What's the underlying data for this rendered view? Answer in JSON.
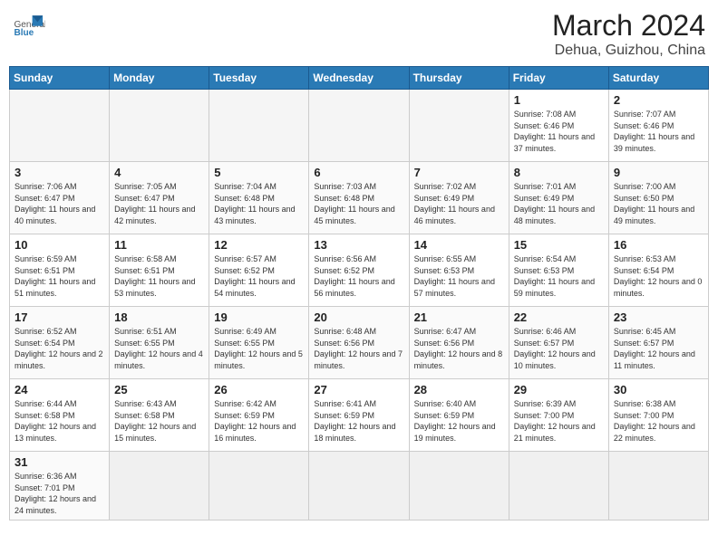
{
  "header": {
    "logo_general": "General",
    "logo_blue": "Blue",
    "title": "March 2024",
    "subtitle": "Dehua, Guizhou, China"
  },
  "weekdays": [
    "Sunday",
    "Monday",
    "Tuesday",
    "Wednesday",
    "Thursday",
    "Friday",
    "Saturday"
  ],
  "weeks": [
    [
      {
        "day": "",
        "info": ""
      },
      {
        "day": "",
        "info": ""
      },
      {
        "day": "",
        "info": ""
      },
      {
        "day": "",
        "info": ""
      },
      {
        "day": "",
        "info": ""
      },
      {
        "day": "1",
        "info": "Sunrise: 7:08 AM\nSunset: 6:46 PM\nDaylight: 11 hours and 37 minutes."
      },
      {
        "day": "2",
        "info": "Sunrise: 7:07 AM\nSunset: 6:46 PM\nDaylight: 11 hours and 39 minutes."
      }
    ],
    [
      {
        "day": "3",
        "info": "Sunrise: 7:06 AM\nSunset: 6:47 PM\nDaylight: 11 hours and 40 minutes."
      },
      {
        "day": "4",
        "info": "Sunrise: 7:05 AM\nSunset: 6:47 PM\nDaylight: 11 hours and 42 minutes."
      },
      {
        "day": "5",
        "info": "Sunrise: 7:04 AM\nSunset: 6:48 PM\nDaylight: 11 hours and 43 minutes."
      },
      {
        "day": "6",
        "info": "Sunrise: 7:03 AM\nSunset: 6:48 PM\nDaylight: 11 hours and 45 minutes."
      },
      {
        "day": "7",
        "info": "Sunrise: 7:02 AM\nSunset: 6:49 PM\nDaylight: 11 hours and 46 minutes."
      },
      {
        "day": "8",
        "info": "Sunrise: 7:01 AM\nSunset: 6:49 PM\nDaylight: 11 hours and 48 minutes."
      },
      {
        "day": "9",
        "info": "Sunrise: 7:00 AM\nSunset: 6:50 PM\nDaylight: 11 hours and 49 minutes."
      }
    ],
    [
      {
        "day": "10",
        "info": "Sunrise: 6:59 AM\nSunset: 6:51 PM\nDaylight: 11 hours and 51 minutes."
      },
      {
        "day": "11",
        "info": "Sunrise: 6:58 AM\nSunset: 6:51 PM\nDaylight: 11 hours and 53 minutes."
      },
      {
        "day": "12",
        "info": "Sunrise: 6:57 AM\nSunset: 6:52 PM\nDaylight: 11 hours and 54 minutes."
      },
      {
        "day": "13",
        "info": "Sunrise: 6:56 AM\nSunset: 6:52 PM\nDaylight: 11 hours and 56 minutes."
      },
      {
        "day": "14",
        "info": "Sunrise: 6:55 AM\nSunset: 6:53 PM\nDaylight: 11 hours and 57 minutes."
      },
      {
        "day": "15",
        "info": "Sunrise: 6:54 AM\nSunset: 6:53 PM\nDaylight: 11 hours and 59 minutes."
      },
      {
        "day": "16",
        "info": "Sunrise: 6:53 AM\nSunset: 6:54 PM\nDaylight: 12 hours and 0 minutes."
      }
    ],
    [
      {
        "day": "17",
        "info": "Sunrise: 6:52 AM\nSunset: 6:54 PM\nDaylight: 12 hours and 2 minutes."
      },
      {
        "day": "18",
        "info": "Sunrise: 6:51 AM\nSunset: 6:55 PM\nDaylight: 12 hours and 4 minutes."
      },
      {
        "day": "19",
        "info": "Sunrise: 6:49 AM\nSunset: 6:55 PM\nDaylight: 12 hours and 5 minutes."
      },
      {
        "day": "20",
        "info": "Sunrise: 6:48 AM\nSunset: 6:56 PM\nDaylight: 12 hours and 7 minutes."
      },
      {
        "day": "21",
        "info": "Sunrise: 6:47 AM\nSunset: 6:56 PM\nDaylight: 12 hours and 8 minutes."
      },
      {
        "day": "22",
        "info": "Sunrise: 6:46 AM\nSunset: 6:57 PM\nDaylight: 12 hours and 10 minutes."
      },
      {
        "day": "23",
        "info": "Sunrise: 6:45 AM\nSunset: 6:57 PM\nDaylight: 12 hours and 11 minutes."
      }
    ],
    [
      {
        "day": "24",
        "info": "Sunrise: 6:44 AM\nSunset: 6:58 PM\nDaylight: 12 hours and 13 minutes."
      },
      {
        "day": "25",
        "info": "Sunrise: 6:43 AM\nSunset: 6:58 PM\nDaylight: 12 hours and 15 minutes."
      },
      {
        "day": "26",
        "info": "Sunrise: 6:42 AM\nSunset: 6:59 PM\nDaylight: 12 hours and 16 minutes."
      },
      {
        "day": "27",
        "info": "Sunrise: 6:41 AM\nSunset: 6:59 PM\nDaylight: 12 hours and 18 minutes."
      },
      {
        "day": "28",
        "info": "Sunrise: 6:40 AM\nSunset: 6:59 PM\nDaylight: 12 hours and 19 minutes."
      },
      {
        "day": "29",
        "info": "Sunrise: 6:39 AM\nSunset: 7:00 PM\nDaylight: 12 hours and 21 minutes."
      },
      {
        "day": "30",
        "info": "Sunrise: 6:38 AM\nSunset: 7:00 PM\nDaylight: 12 hours and 22 minutes."
      }
    ],
    [
      {
        "day": "31",
        "info": "Sunrise: 6:36 AM\nSunset: 7:01 PM\nDaylight: 12 hours and 24 minutes."
      },
      {
        "day": "",
        "info": ""
      },
      {
        "day": "",
        "info": ""
      },
      {
        "day": "",
        "info": ""
      },
      {
        "day": "",
        "info": ""
      },
      {
        "day": "",
        "info": ""
      },
      {
        "day": "",
        "info": ""
      }
    ]
  ]
}
